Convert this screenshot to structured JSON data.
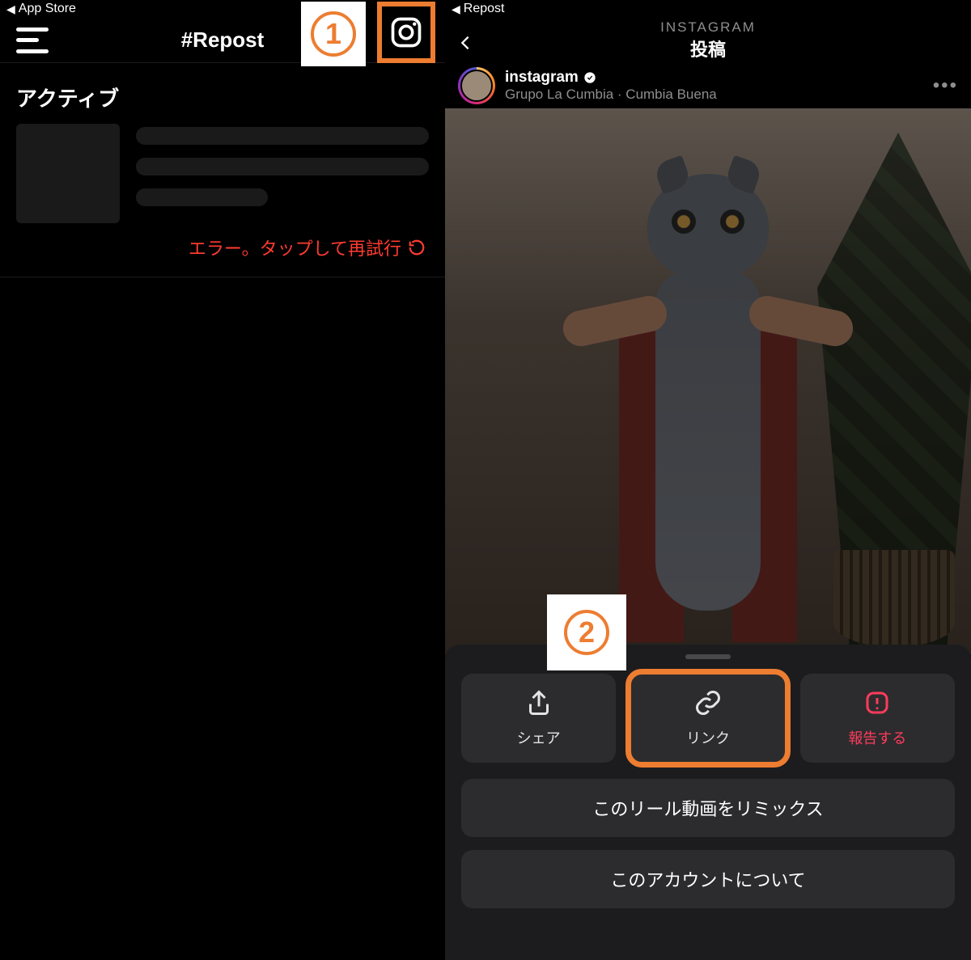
{
  "left": {
    "status_back": "App Store",
    "header_title": "#Repost",
    "section_title": "アクティブ",
    "error_text": "エラー。タップして再試行",
    "badge_number": "1"
  },
  "right": {
    "status_back": "Repost",
    "header_brand": "INSTAGRAM",
    "header_sub": "投稿",
    "post_user": "instagram",
    "post_music": "Grupo La Cumbia · Cumbia Buena",
    "more": "•••",
    "badge_number": "2",
    "actions": {
      "share": "シェア",
      "link": "リンク",
      "report": "報告する"
    },
    "menu": {
      "remix": "このリール動画をリミックス",
      "about_account": "このアカウントについて"
    }
  }
}
